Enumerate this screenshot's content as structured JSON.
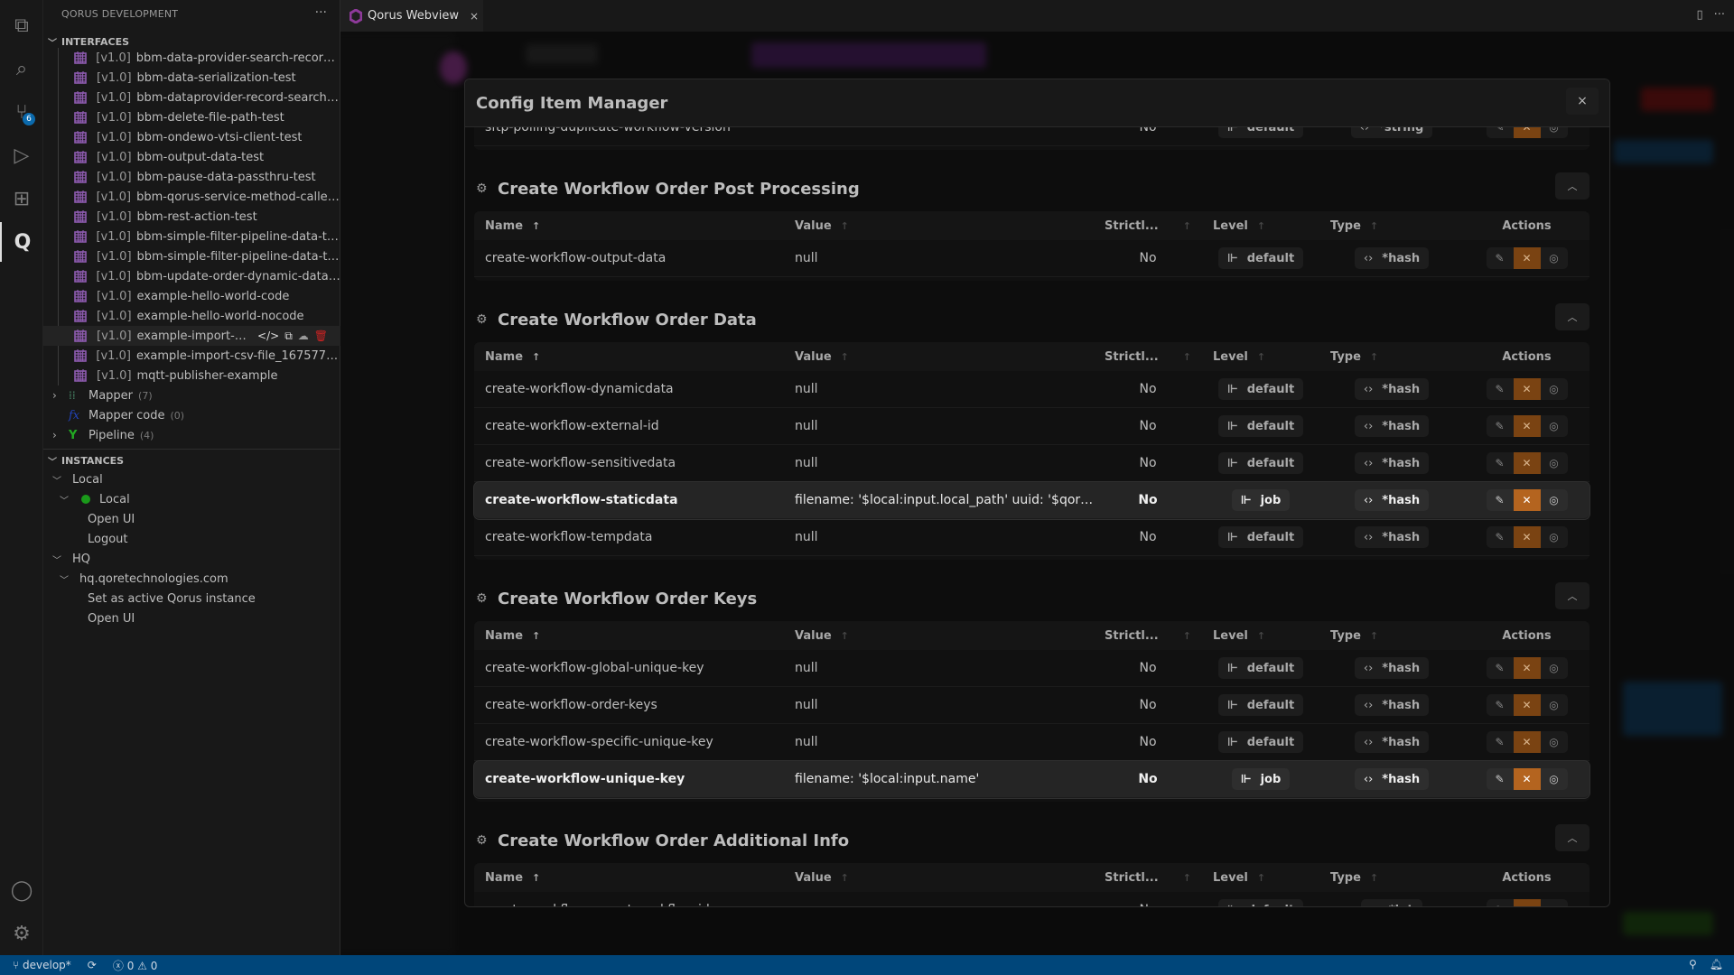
{
  "activity_bar": {
    "items": [
      {
        "icon": "explorer-icon",
        "glyph": "⧉"
      },
      {
        "icon": "search-icon",
        "glyph": "⌕"
      },
      {
        "icon": "source-control-icon",
        "glyph": "⑂",
        "badge": "6"
      },
      {
        "icon": "run-debug-icon",
        "glyph": "▷"
      },
      {
        "icon": "extensions-icon",
        "glyph": "⊞"
      },
      {
        "icon": "qorus-icon",
        "glyph": "Q",
        "active": true
      }
    ],
    "bottom": [
      {
        "icon": "account-icon",
        "glyph": "◯"
      },
      {
        "icon": "settings-gear-icon",
        "glyph": "⚙"
      }
    ]
  },
  "sidebar": {
    "title": "QORUS DEVELOPMENT",
    "more": "···",
    "interfaces_header": "INTERFACES",
    "interfaces": [
      {
        "ver": "[v1.0]",
        "name": "bbm-data-provider-search-record-…"
      },
      {
        "ver": "[v1.0]",
        "name": "bbm-data-serialization-test"
      },
      {
        "ver": "[v1.0]",
        "name": "bbm-dataprovider-record-search-…"
      },
      {
        "ver": "[v1.0]",
        "name": "bbm-delete-file-path-test"
      },
      {
        "ver": "[v1.0]",
        "name": "bbm-ondewo-vtsi-client-test"
      },
      {
        "ver": "[v1.0]",
        "name": "bbm-output-data-test"
      },
      {
        "ver": "[v1.0]",
        "name": "bbm-pause-data-passthru-test"
      },
      {
        "ver": "[v1.0]",
        "name": "bbm-qorus-service-method-caller…"
      },
      {
        "ver": "[v1.0]",
        "name": "bbm-rest-action-test"
      },
      {
        "ver": "[v1.0]",
        "name": "bbm-simple-filter-pipeline-data-test"
      },
      {
        "ver": "[v1.0]",
        "name": "bbm-simple-filter-pipeline-data-t…"
      },
      {
        "ver": "[v1.0]",
        "name": "bbm-update-order-dynamic-data-…"
      },
      {
        "ver": "[v1.0]",
        "name": "example-hello-world-code"
      },
      {
        "ver": "[v1.0]",
        "name": "example-hello-world-nocode"
      },
      {
        "ver": "[v1.0]",
        "name": "example-import-csv…",
        "hover": true
      },
      {
        "ver": "[v1.0]",
        "name": "example-import-csv-file_1675773…"
      },
      {
        "ver": "[v1.0]",
        "name": "mqtt-publisher-example"
      }
    ],
    "groups": [
      {
        "label": "Mapper",
        "count": "(7)",
        "icon": "mapper-icon",
        "expandable": true
      },
      {
        "label": "Mapper code",
        "count": "(0)",
        "icon": "mapper-code-icon",
        "expandable": false
      },
      {
        "label": "Pipeline",
        "count": "(4)",
        "icon": "pipeline-icon",
        "expandable": true
      }
    ],
    "instances_header": "INSTANCES",
    "instances": [
      {
        "label": "Local",
        "indent": 1,
        "chev": true
      },
      {
        "label": "Local",
        "indent": 2,
        "chev": true,
        "online": true
      },
      {
        "label": "Open UI",
        "indent": 3
      },
      {
        "label": "Logout",
        "indent": 3
      },
      {
        "label": "HQ",
        "indent": 1,
        "chev": true
      },
      {
        "label": "hq.qoretechnologies.com",
        "indent": 2,
        "chev": true
      },
      {
        "label": "Set as active Qorus instance",
        "indent": 3
      },
      {
        "label": "Open UI",
        "indent": 3
      }
    ]
  },
  "tab": {
    "label": "Qorus Webview",
    "close": "×"
  },
  "modal": {
    "title": "Config Item Manager",
    "close": "×",
    "columns": {
      "name": "Name",
      "value": "Value",
      "strictly": "Strictl...",
      "level": "Level",
      "type": "Type",
      "actions": "Actions"
    },
    "partial_row": {
      "name": "sftp-polling-duplicate-workflow-version",
      "value": "",
      "strictly": "No",
      "level": "default",
      "type": "*string"
    },
    "sections": [
      {
        "title": "Create Workflow Order Post Processing",
        "rows": [
          {
            "name": "create-workflow-output-data",
            "value": "null",
            "strictly": "No",
            "level": "default",
            "type": "*hash"
          }
        ]
      },
      {
        "title": "Create Workflow Order Data",
        "rows": [
          {
            "name": "create-workflow-dynamicdata",
            "value": "null",
            "strictly": "No",
            "level": "default",
            "type": "*hash"
          },
          {
            "name": "create-workflow-external-id",
            "value": "null",
            "strictly": "No",
            "level": "default",
            "type": "*hash"
          },
          {
            "name": "create-workflow-sensitivedata",
            "value": "null",
            "strictly": "No",
            "level": "default",
            "type": "*hash"
          },
          {
            "name": "create-workflow-staticdata",
            "value": "filename: '$local:input.local_path' uuid: '$qor…",
            "strictly": "No",
            "level": "job",
            "type": "*hash",
            "highlight": true
          },
          {
            "name": "create-workflow-tempdata",
            "value": "null",
            "strictly": "No",
            "level": "default",
            "type": "*hash"
          }
        ]
      },
      {
        "title": "Create Workflow Order Keys",
        "rows": [
          {
            "name": "create-workflow-global-unique-key",
            "value": "null",
            "strictly": "No",
            "level": "default",
            "type": "*hash"
          },
          {
            "name": "create-workflow-order-keys",
            "value": "null",
            "strictly": "No",
            "level": "default",
            "type": "*hash"
          },
          {
            "name": "create-workflow-specific-unique-key",
            "value": "null",
            "strictly": "No",
            "level": "default",
            "type": "*hash"
          },
          {
            "name": "create-workflow-unique-key",
            "value": "filename: '$local:input.name'",
            "strictly": "No",
            "level": "job",
            "type": "*hash",
            "highlight": true
          }
        ]
      },
      {
        "title": "Create Workflow Order Additional Info",
        "rows": [
          {
            "name": "create-workflow-parent-workflow-id",
            "value": "",
            "strictly": "No",
            "level": "default",
            "type": "*int"
          }
        ]
      }
    ]
  },
  "statusbar": {
    "branch": "develop*",
    "errors": "0",
    "warnings": "0"
  },
  "colors": {
    "accent": "#b4641f",
    "status_bar": "#00467a",
    "interface_icon": "#8e5bb0",
    "online": "#1a9a1a"
  }
}
